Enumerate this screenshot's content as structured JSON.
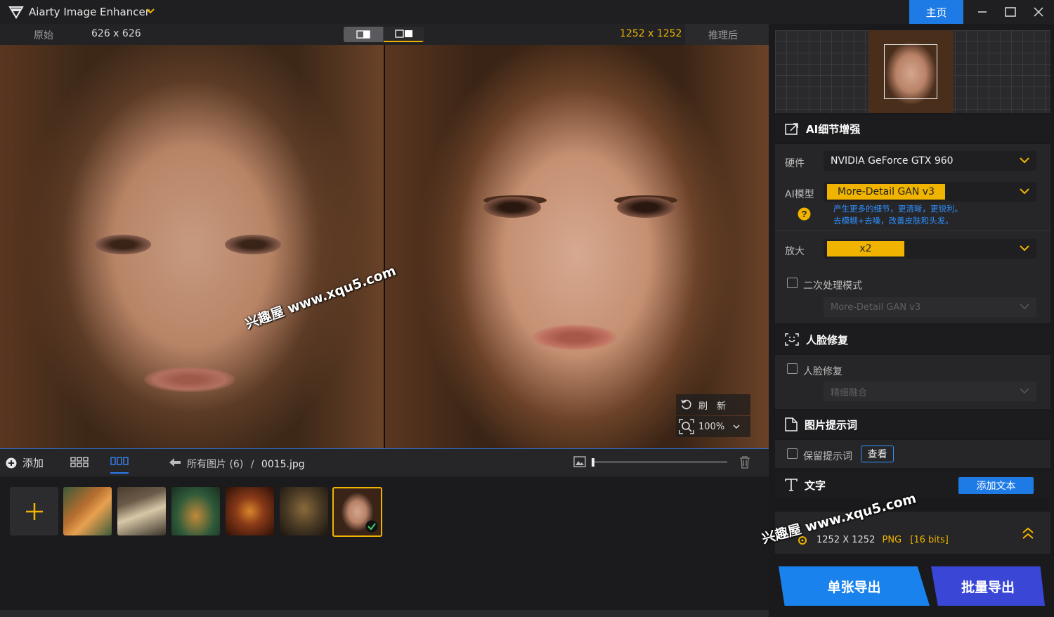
{
  "app": {
    "title": "Aiarty Image Enhancer",
    "home_label": "主页"
  },
  "compare": {
    "original_label": "原始",
    "original_size": "626 x 626",
    "enhanced_size": "1252 x 1252",
    "after_label": "推理后",
    "refresh_label": "刷　新",
    "zoom_level": "100%"
  },
  "watermark": "兴趣屋 www.xqu5.com",
  "toolbar": {
    "add_label": "添加",
    "breadcrumb_all": "所有图片 (6)",
    "breadcrumb_sep": "/",
    "breadcrumb_file": "0015.jpg"
  },
  "thumbnails": [
    {
      "name": "tiger",
      "colors": [
        "#b56d2e",
        "#3c5a3a"
      ]
    },
    {
      "name": "butterfly",
      "colors": [
        "#6b5a48",
        "#d8c8a8"
      ]
    },
    {
      "name": "jar-forest",
      "colors": [
        "#2f5a3a",
        "#c08a3a"
      ]
    },
    {
      "name": "burger",
      "colors": [
        "#5a2a14",
        "#d8862a"
      ]
    },
    {
      "name": "dog-steampunk",
      "colors": [
        "#3a3020",
        "#8a6a3a"
      ]
    },
    {
      "name": "girl-portrait",
      "colors": [
        "#3a2418",
        "#d3a68c"
      ],
      "selected": true
    }
  ],
  "panel": {
    "ai_detail": {
      "title": "AI细节增强",
      "hardware_label": "硬件",
      "hardware_value": "NVIDIA GeForce GTX 960",
      "model_label": "AI模型",
      "model_value": "More-Detail GAN  v3",
      "model_desc_1": "产生更多的细节，更清晰，更锐利。",
      "model_desc_2": "去模糊+去噪，改善皮肤和头发。",
      "upscale_label": "放大",
      "upscale_value": "x2",
      "second_pass_label": "二次处理模式",
      "second_pass_model": "More-Detail GAN  v3"
    },
    "face": {
      "title": "人脸修复",
      "checkbox_label": "人脸修复",
      "mode_value": "精细融合"
    },
    "prompt": {
      "title": "图片提示词",
      "checkbox_label": "保留提示词",
      "view_label": "查看"
    },
    "text": {
      "title": "文字",
      "add_label": "添加文本"
    },
    "output": {
      "size": "1252 X 1252",
      "format": "PNG",
      "bits": "[16 bits]"
    },
    "export_single": "单张导出",
    "export_batch": "批量导出"
  },
  "colors": {
    "accent_blue": "#1e7be6",
    "accent_yellow": "#f0b400",
    "desc_blue": "#2f8fff"
  }
}
